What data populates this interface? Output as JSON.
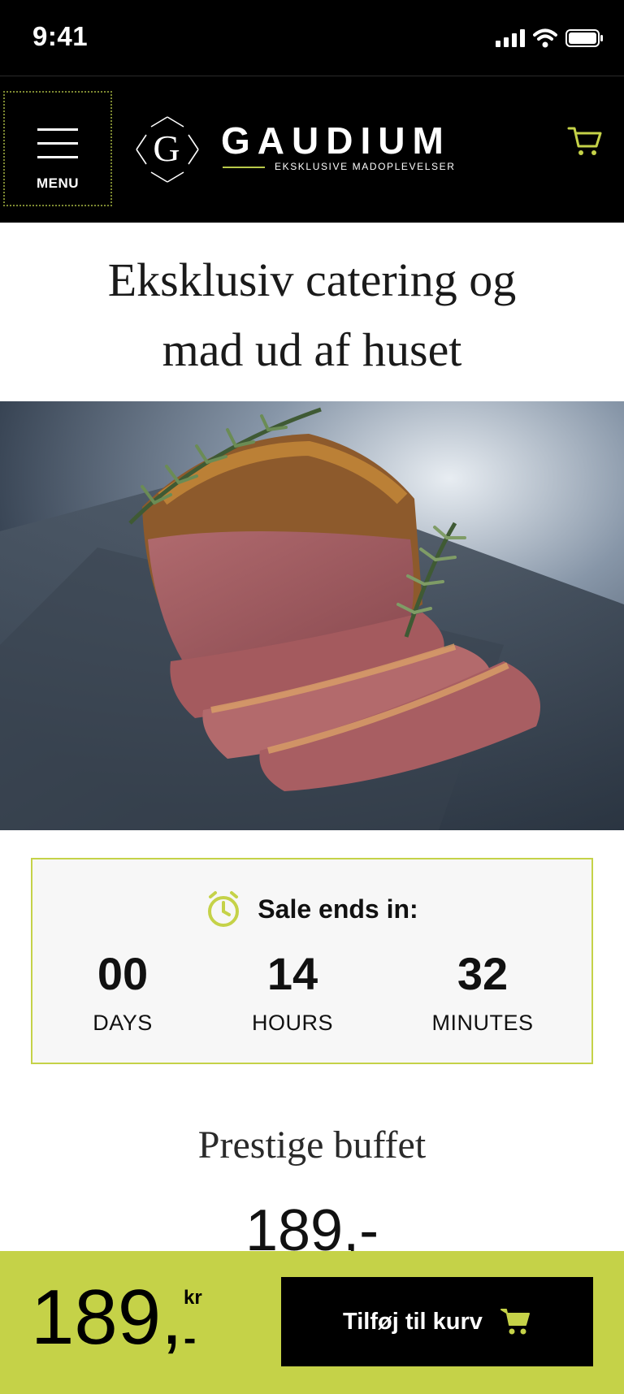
{
  "status_bar": {
    "time": "9:41"
  },
  "header": {
    "menu_label": "MENU",
    "logo_letter": "G",
    "brand_name": "GAUDIUM",
    "brand_tagline": "EKSKLUSIVE MADOPLEVELSER"
  },
  "page": {
    "title_line1": "Eksklusiv catering og",
    "title_line2": "mad ud af huset"
  },
  "countdown": {
    "label": "Sale ends in:",
    "days": "00",
    "days_label": "DAYS",
    "hours": "14",
    "hours_label": "HOURS",
    "minutes": "32",
    "minutes_label": "MINUTES"
  },
  "product": {
    "name": "Prestige buffet",
    "price": "189,-"
  },
  "bottom_bar": {
    "price": "189,",
    "currency": "kr",
    "dash": "-",
    "add_to_cart_label": "Tilføj til kurv"
  },
  "icons": {
    "menu": "hamburger-icon",
    "cart": "shopping-cart-icon",
    "timer": "stopwatch-icon",
    "signal": "cellular-signal-icon",
    "wifi": "wifi-icon",
    "battery": "battery-icon"
  },
  "colors": {
    "accent": "#c5d248",
    "header_bg": "#000000",
    "countdown_bg": "#f7f7f7"
  }
}
